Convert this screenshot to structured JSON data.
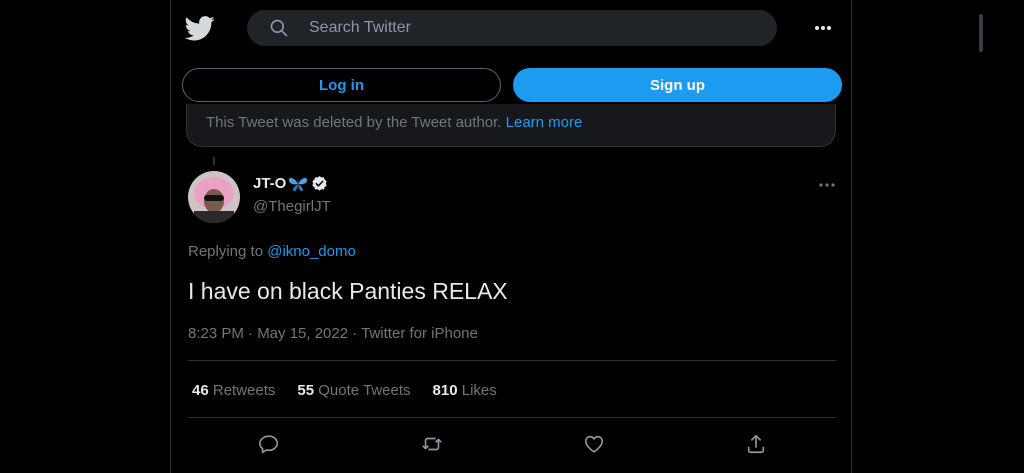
{
  "header": {
    "search_placeholder": "Search Twitter",
    "icons": [
      "twitter-bird-icon",
      "search-icon",
      "more-horizontal-icon"
    ]
  },
  "auth": {
    "login_label": "Log in",
    "signup_label": "Sign up"
  },
  "deleted_notice": {
    "text": "This Tweet was deleted by the Tweet author.",
    "link": "Learn more"
  },
  "tweet": {
    "display_name": "JT-O",
    "name_emoji": "butterfly",
    "verified": true,
    "handle": "@ThegirlJT",
    "replying_prefix": "Replying to",
    "replying_to": "@ikno_domo",
    "text": "I have on black Panties RELAX",
    "meta": "8:23 PM · May 15, 2022 · Twitter for iPhone",
    "stats": {
      "retweets_count": "46",
      "retweets_label": "Retweets",
      "quotes_count": "55",
      "quotes_label": "Quote Tweets",
      "likes_count": "810",
      "likes_label": "Likes"
    },
    "actions": [
      "reply-icon",
      "retweet-icon",
      "like-icon",
      "share-icon"
    ]
  },
  "colors": {
    "accent": "#1d9bf0",
    "background": "#000000",
    "muted_text": "#71767b",
    "primary_text": "#e7e9ea"
  }
}
